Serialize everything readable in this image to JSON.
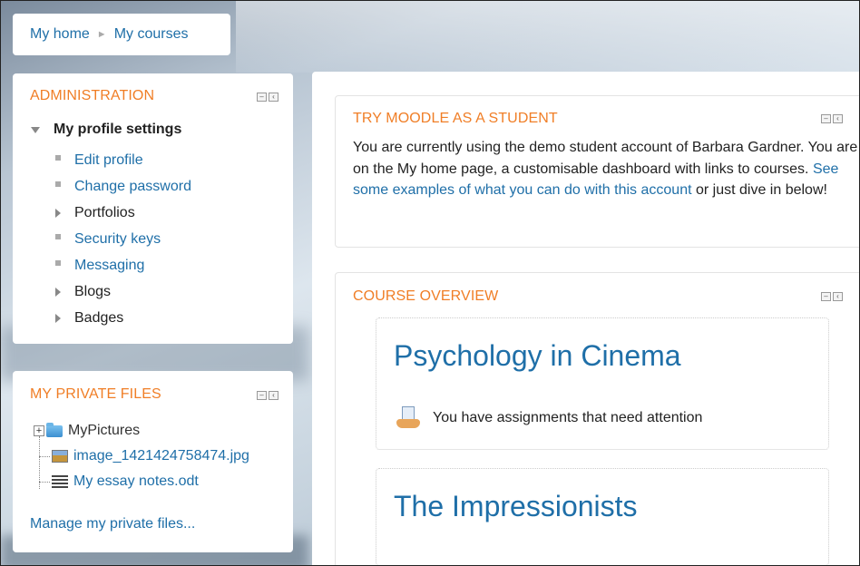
{
  "breadcrumb": {
    "home": "My home",
    "courses": "My courses"
  },
  "administration": {
    "title": "ADMINISTRATION",
    "section": "My profile settings",
    "items": [
      {
        "label": "Edit profile",
        "type": "link"
      },
      {
        "label": "Change password",
        "type": "link"
      },
      {
        "label": "Portfolios",
        "type": "expandable"
      },
      {
        "label": "Security keys",
        "type": "link"
      },
      {
        "label": "Messaging",
        "type": "link"
      },
      {
        "label": "Blogs",
        "type": "expandable"
      },
      {
        "label": "Badges",
        "type": "expandable"
      }
    ]
  },
  "private_files": {
    "title": "MY PRIVATE FILES",
    "folder": "MyPictures",
    "files": [
      "image_1421424758474.jpg",
      "My essay notes.odt"
    ],
    "manage": "Manage my private files..."
  },
  "try_moodle": {
    "title": "TRY MOODLE AS A STUDENT",
    "text_before": "You are currently using the demo student account of Barbara Gardner. You are on the My home page, a customisable dashboard with links to courses. ",
    "link": "See some examples of what you can do with this account",
    "text_after": " or just dive in below!"
  },
  "course_overview": {
    "title": "COURSE OVERVIEW",
    "courses": [
      {
        "name": "Psychology in Cinema",
        "note": "You have assignments that need attention"
      },
      {
        "name": "The Impressionists"
      }
    ]
  },
  "colors": {
    "accent": "#f07e26",
    "link": "#1f6fa8"
  },
  "icons": [
    "minimize-icon",
    "dock-icon",
    "folder-icon",
    "image-file-icon",
    "document-file-icon",
    "assignment-icon"
  ]
}
